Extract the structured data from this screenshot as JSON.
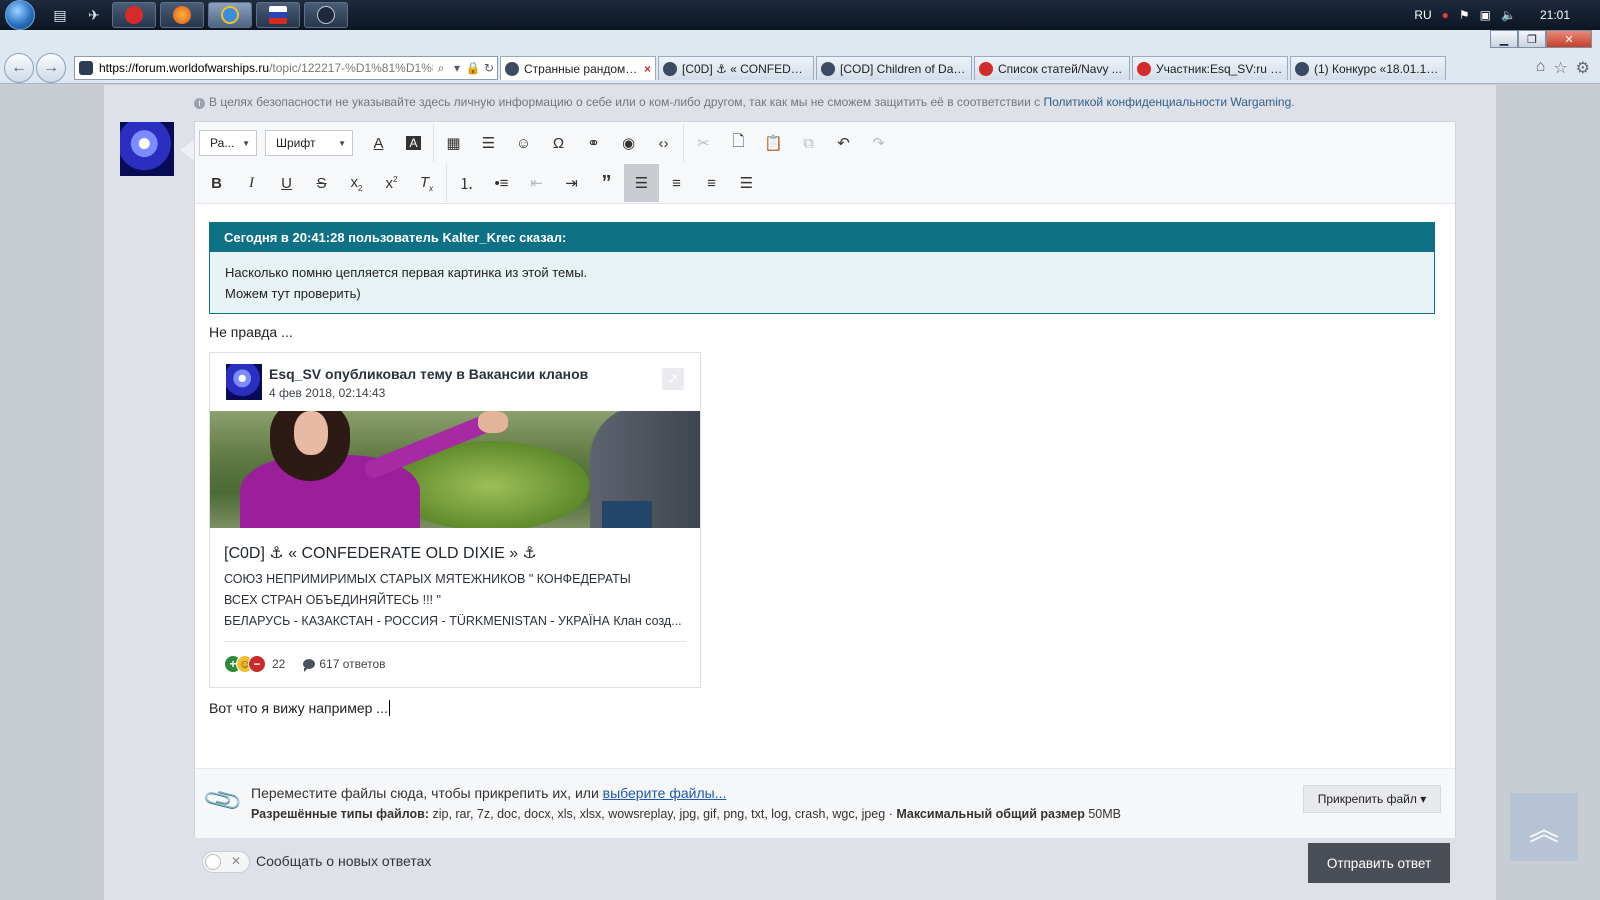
{
  "taskbar": {
    "lang": "RU",
    "clock": "21:01"
  },
  "browser": {
    "url_host": "https://forum.worldofwarships.ru",
    "url_path": "/topic/122217-%D1%81%D1%8...",
    "tabs": [
      {
        "label": "Странные рандомн...",
        "active": true
      },
      {
        "label": "[C0D] ⚓ « CONFEDERA..."
      },
      {
        "label": "[COD] Children of Dago..."
      },
      {
        "label": "Список статей/Navy ..."
      },
      {
        "label": "Участник:Esq_SV:ru — ..."
      },
      {
        "label": "(1) Конкурс «18.01.19»...."
      }
    ]
  },
  "privacy": {
    "text": "В целях безопасности не указывайте здесь личную информацию о себе или о ком-либо другом, так как мы не сможем защитить её в соответствии с ",
    "link": "Политикой конфиденциальности Wargaming",
    "tail": "."
  },
  "toolbar": {
    "format_select": "Ра...",
    "font_select": "Шрифт"
  },
  "quote": {
    "header": "Сегодня в 20:41:28 пользователь Kalter_Krec сказал:",
    "line1": "Насколько помню цепляется первая картинка из этой темы.",
    "line2": "Можем тут проверить)"
  },
  "reply": {
    "p1": "Не правда ...",
    "p2": "Вот что я вижу например ..."
  },
  "embed": {
    "title": "Esq_SV опубликовал тему в Вакансии кланов",
    "date": "4 фев 2018, 02:14:43",
    "heading": "[C0D] ⚓ « CONFEDERATE OLD DIXIE » ⚓",
    "desc1": "СОЮЗ НЕПРИМИРИМЫХ СТАРЫХ МЯТЕЖНИКОВ     \" КОНФЕДЕРАТЫ",
    "desc2": "ВСЕХ СТРАН ОБЪЕДИНЯЙТЕСЬ !!! \"",
    "desc3": "БЕЛАРУСЬ - КАЗАКСТАН - РОССИЯ - TÜRKMENISTAN - УКРАЇНА Клан созд...",
    "reputation": "22",
    "replies": "617 ответов"
  },
  "attach": {
    "drop_text": "Переместите файлы сюда, чтобы прикрепить их, или ",
    "choose_link": "выберите файлы...",
    "types_label": "Разрешённые типы файлов:",
    "types": " zip, rar, 7z, doc, docx, xls, xlsx, wowsreplay, jpg, gif, png, txt, log, crash, wgc, jpeg · ",
    "max_label": "Максимальный общий размер",
    "max_value": " 50MB",
    "button": "Прикрепить файл ▾"
  },
  "footer": {
    "notify_label": "Сообщать о новых ответах",
    "submit": "Отправить ответ"
  }
}
